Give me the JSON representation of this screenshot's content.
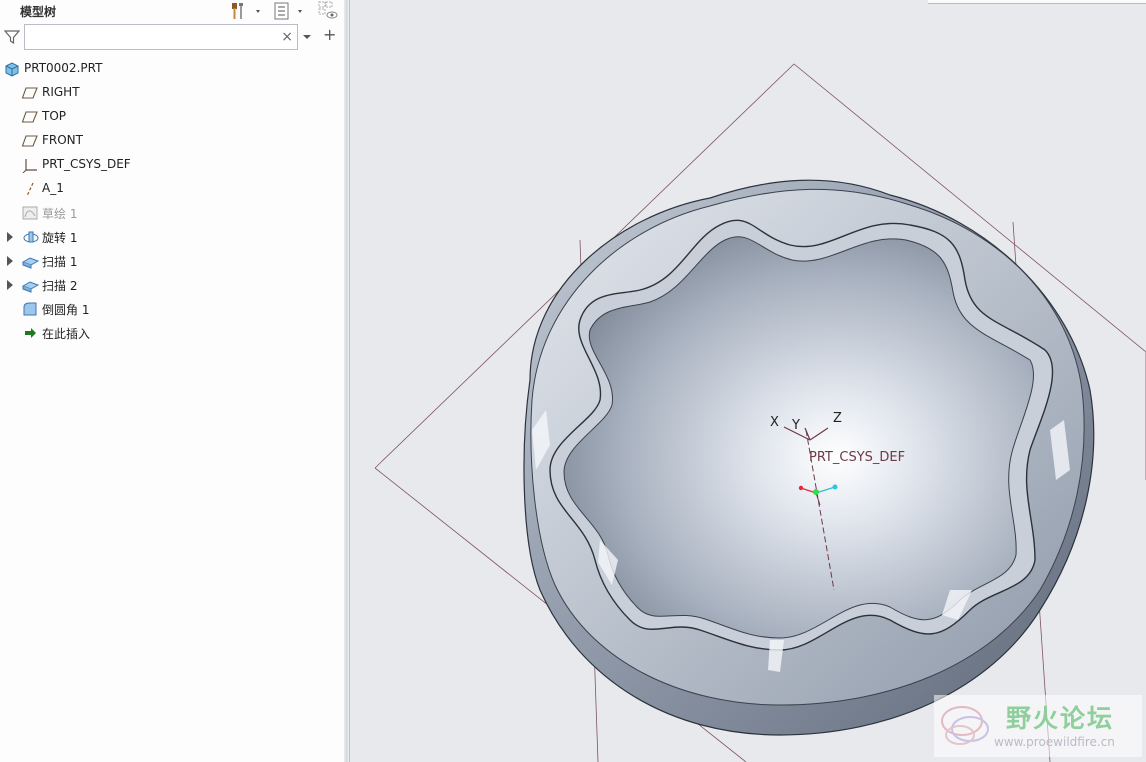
{
  "panel": {
    "title": "模型树",
    "search": {
      "value": "",
      "clear_glyph": "×",
      "add_glyph": "+"
    }
  },
  "tree": [
    {
      "label": "PRT0002.PRT",
      "icon": "part-icon",
      "expandable": false,
      "muted": false
    },
    {
      "label": "RIGHT",
      "icon": "datum-plane-icon",
      "expandable": false,
      "muted": false
    },
    {
      "label": "TOP",
      "icon": "datum-plane-icon",
      "expandable": false,
      "muted": false
    },
    {
      "label": "FRONT",
      "icon": "datum-plane-icon",
      "expandable": false,
      "muted": false
    },
    {
      "label": "PRT_CSYS_DEF",
      "icon": "csys-icon",
      "expandable": false,
      "muted": false
    },
    {
      "label": "A_1",
      "icon": "axis-icon",
      "expandable": false,
      "muted": false
    },
    {
      "label": "草绘 1",
      "icon": "sketch-icon",
      "expandable": false,
      "muted": true
    },
    {
      "label": "旋转 1",
      "icon": "revolve-icon",
      "expandable": true,
      "muted": false
    },
    {
      "label": "扫描 1",
      "icon": "sweep-icon",
      "expandable": true,
      "muted": false
    },
    {
      "label": "扫描 2",
      "icon": "sweep-icon",
      "expandable": true,
      "muted": false
    },
    {
      "label": "倒圆角 1",
      "icon": "round-icon",
      "expandable": false,
      "muted": false
    },
    {
      "label": "在此插入",
      "icon": "insert-here-arrow-icon",
      "expandable": false,
      "muted": false
    }
  ],
  "viewport": {
    "axis_labels": {
      "x": "X",
      "y": "Y",
      "z": "Z"
    },
    "csys_label": "PRT_CSYS_DEF"
  },
  "watermark": {
    "title": "野火论坛",
    "url": "www.proewildfire.cn"
  },
  "colors": {
    "datum_line": "#6e3a46",
    "panel_bg": "#fdfdfe",
    "viewport_bg": "#e8e9ed",
    "insert_arrow": "#1e7a1e"
  }
}
